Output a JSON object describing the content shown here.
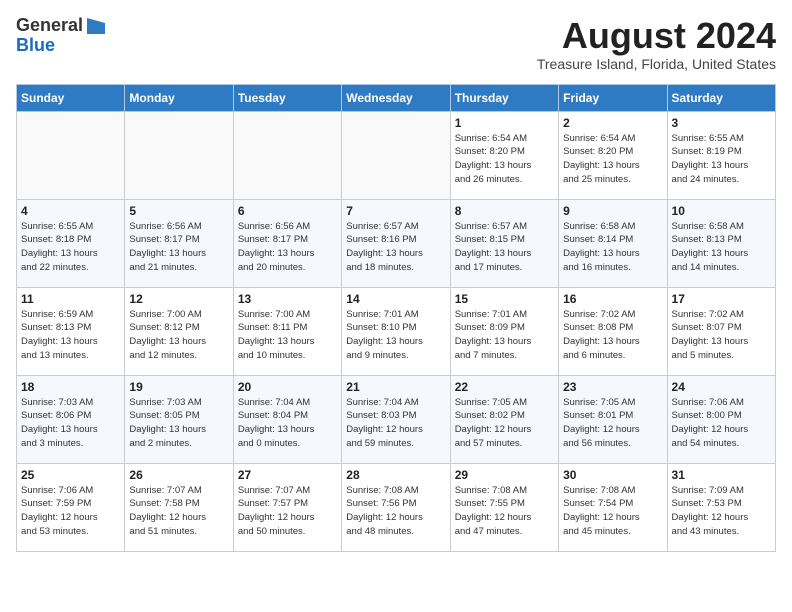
{
  "header": {
    "logo_line1": "General",
    "logo_line2": "Blue",
    "month_title": "August 2024",
    "subtitle": "Treasure Island, Florida, United States"
  },
  "weekdays": [
    "Sunday",
    "Monday",
    "Tuesday",
    "Wednesday",
    "Thursday",
    "Friday",
    "Saturday"
  ],
  "weeks": [
    [
      {
        "day": "",
        "info": ""
      },
      {
        "day": "",
        "info": ""
      },
      {
        "day": "",
        "info": ""
      },
      {
        "day": "",
        "info": ""
      },
      {
        "day": "1",
        "info": "Sunrise: 6:54 AM\nSunset: 8:20 PM\nDaylight: 13 hours\nand 26 minutes."
      },
      {
        "day": "2",
        "info": "Sunrise: 6:54 AM\nSunset: 8:20 PM\nDaylight: 13 hours\nand 25 minutes."
      },
      {
        "day": "3",
        "info": "Sunrise: 6:55 AM\nSunset: 8:19 PM\nDaylight: 13 hours\nand 24 minutes."
      }
    ],
    [
      {
        "day": "4",
        "info": "Sunrise: 6:55 AM\nSunset: 8:18 PM\nDaylight: 13 hours\nand 22 minutes."
      },
      {
        "day": "5",
        "info": "Sunrise: 6:56 AM\nSunset: 8:17 PM\nDaylight: 13 hours\nand 21 minutes."
      },
      {
        "day": "6",
        "info": "Sunrise: 6:56 AM\nSunset: 8:17 PM\nDaylight: 13 hours\nand 20 minutes."
      },
      {
        "day": "7",
        "info": "Sunrise: 6:57 AM\nSunset: 8:16 PM\nDaylight: 13 hours\nand 18 minutes."
      },
      {
        "day": "8",
        "info": "Sunrise: 6:57 AM\nSunset: 8:15 PM\nDaylight: 13 hours\nand 17 minutes."
      },
      {
        "day": "9",
        "info": "Sunrise: 6:58 AM\nSunset: 8:14 PM\nDaylight: 13 hours\nand 16 minutes."
      },
      {
        "day": "10",
        "info": "Sunrise: 6:58 AM\nSunset: 8:13 PM\nDaylight: 13 hours\nand 14 minutes."
      }
    ],
    [
      {
        "day": "11",
        "info": "Sunrise: 6:59 AM\nSunset: 8:13 PM\nDaylight: 13 hours\nand 13 minutes."
      },
      {
        "day": "12",
        "info": "Sunrise: 7:00 AM\nSunset: 8:12 PM\nDaylight: 13 hours\nand 12 minutes."
      },
      {
        "day": "13",
        "info": "Sunrise: 7:00 AM\nSunset: 8:11 PM\nDaylight: 13 hours\nand 10 minutes."
      },
      {
        "day": "14",
        "info": "Sunrise: 7:01 AM\nSunset: 8:10 PM\nDaylight: 13 hours\nand 9 minutes."
      },
      {
        "day": "15",
        "info": "Sunrise: 7:01 AM\nSunset: 8:09 PM\nDaylight: 13 hours\nand 7 minutes."
      },
      {
        "day": "16",
        "info": "Sunrise: 7:02 AM\nSunset: 8:08 PM\nDaylight: 13 hours\nand 6 minutes."
      },
      {
        "day": "17",
        "info": "Sunrise: 7:02 AM\nSunset: 8:07 PM\nDaylight: 13 hours\nand 5 minutes."
      }
    ],
    [
      {
        "day": "18",
        "info": "Sunrise: 7:03 AM\nSunset: 8:06 PM\nDaylight: 13 hours\nand 3 minutes."
      },
      {
        "day": "19",
        "info": "Sunrise: 7:03 AM\nSunset: 8:05 PM\nDaylight: 13 hours\nand 2 minutes."
      },
      {
        "day": "20",
        "info": "Sunrise: 7:04 AM\nSunset: 8:04 PM\nDaylight: 13 hours\nand 0 minutes."
      },
      {
        "day": "21",
        "info": "Sunrise: 7:04 AM\nSunset: 8:03 PM\nDaylight: 12 hours\nand 59 minutes."
      },
      {
        "day": "22",
        "info": "Sunrise: 7:05 AM\nSunset: 8:02 PM\nDaylight: 12 hours\nand 57 minutes."
      },
      {
        "day": "23",
        "info": "Sunrise: 7:05 AM\nSunset: 8:01 PM\nDaylight: 12 hours\nand 56 minutes."
      },
      {
        "day": "24",
        "info": "Sunrise: 7:06 AM\nSunset: 8:00 PM\nDaylight: 12 hours\nand 54 minutes."
      }
    ],
    [
      {
        "day": "25",
        "info": "Sunrise: 7:06 AM\nSunset: 7:59 PM\nDaylight: 12 hours\nand 53 minutes."
      },
      {
        "day": "26",
        "info": "Sunrise: 7:07 AM\nSunset: 7:58 PM\nDaylight: 12 hours\nand 51 minutes."
      },
      {
        "day": "27",
        "info": "Sunrise: 7:07 AM\nSunset: 7:57 PM\nDaylight: 12 hours\nand 50 minutes."
      },
      {
        "day": "28",
        "info": "Sunrise: 7:08 AM\nSunset: 7:56 PM\nDaylight: 12 hours\nand 48 minutes."
      },
      {
        "day": "29",
        "info": "Sunrise: 7:08 AM\nSunset: 7:55 PM\nDaylight: 12 hours\nand 47 minutes."
      },
      {
        "day": "30",
        "info": "Sunrise: 7:08 AM\nSunset: 7:54 PM\nDaylight: 12 hours\nand 45 minutes."
      },
      {
        "day": "31",
        "info": "Sunrise: 7:09 AM\nSunset: 7:53 PM\nDaylight: 12 hours\nand 43 minutes."
      }
    ]
  ]
}
